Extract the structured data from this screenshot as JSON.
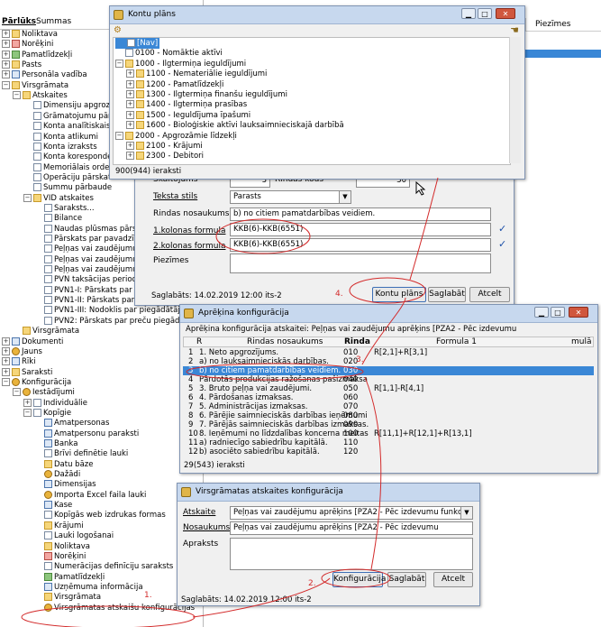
{
  "left_tabs": [
    "Pārlūks",
    "Summas"
  ],
  "left_tree": [
    {
      "label": "Noliktava",
      "level": 0,
      "expander": "+",
      "icon": "folder"
    },
    {
      "label": "Norēķini",
      "level": 0,
      "expander": "+",
      "icon": "red"
    },
    {
      "label": "Pamatlīdzekļi",
      "level": 0,
      "expander": "+",
      "icon": "green"
    },
    {
      "label": "Pasts",
      "level": 0,
      "expander": "+",
      "icon": "folder"
    },
    {
      "label": "Personāla vadība",
      "level": 0,
      "expander": "+",
      "icon": "blue"
    },
    {
      "label": "Virsgrāmata",
      "level": 0,
      "expander": "−",
      "icon": "folder"
    },
    {
      "label": "Atskaites",
      "level": 1,
      "expander": "−",
      "icon": "folder"
    },
    {
      "label": "Dimensiju apgrozīj",
      "level": 2,
      "expander": "",
      "icon": "doc"
    },
    {
      "label": "Grāmatojumu pārskat",
      "level": 2,
      "expander": "",
      "icon": "doc"
    },
    {
      "label": "Konta analītiskais",
      "level": 2,
      "expander": "",
      "icon": "doc"
    },
    {
      "label": "Konta atlikumi",
      "level": 2,
      "expander": "",
      "icon": "doc"
    },
    {
      "label": "Konta izraksts",
      "level": 2,
      "expander": "",
      "icon": "doc"
    },
    {
      "label": "Konta koresponde",
      "level": 2,
      "expander": "",
      "icon": "doc"
    },
    {
      "label": "Memoriālais orderis",
      "level": 2,
      "expander": "",
      "icon": "doc"
    },
    {
      "label": "Operāciju pārskats",
      "level": 2,
      "expander": "",
      "icon": "doc"
    },
    {
      "label": "Summu pārbaude",
      "level": 2,
      "expander": "",
      "icon": "doc"
    },
    {
      "label": "VID atskaites",
      "level": 2,
      "expander": "−",
      "icon": "folder"
    },
    {
      "label": "Saraksts...",
      "level": 3,
      "expander": "",
      "icon": "doc"
    },
    {
      "label": "Bilance",
      "level": 3,
      "expander": "",
      "icon": "doc"
    },
    {
      "label": "Naudas plūsmas pārskats",
      "level": 3,
      "expander": "",
      "icon": "doc"
    },
    {
      "label": "Pārskats par pavadzīmju nu",
      "level": 3,
      "expander": "",
      "icon": "doc"
    },
    {
      "label": "Peļņas vai zaudējumu aprēķins",
      "level": 3,
      "expander": "",
      "icon": "doc"
    },
    {
      "label": "Peļņas vai zaudējumu aprēķins",
      "level": 3,
      "expander": "",
      "icon": "doc"
    },
    {
      "label": "Peļņas vai zaudējumu aprēķins",
      "level": 3,
      "expander": "",
      "icon": "doc"
    },
    {
      "label": "PVN taksācijas perioda dek",
      "level": 3,
      "expander": "",
      "icon": "doc"
    },
    {
      "label": "PVN1-I: Pārskats par priekš",
      "level": 3,
      "expander": "",
      "icon": "doc"
    },
    {
      "label": "PVN1-II: Pārskats par prieks",
      "level": 3,
      "expander": "",
      "icon": "doc"
    },
    {
      "label": "PVN1-III: Nodoklis par piegādātājam p",
      "level": 3,
      "expander": "",
      "icon": "doc"
    },
    {
      "label": "PVN2: Pārskats par preču piegādēm",
      "level": 3,
      "expander": "",
      "icon": "doc"
    },
    {
      "label": "Virsgrāmata",
      "level": 1,
      "expander": "",
      "icon": "folder"
    },
    {
      "label": "Dokumenti",
      "level": 0,
      "expander": "+",
      "icon": "blue"
    },
    {
      "label": "Jauns",
      "level": 0,
      "expander": "+",
      "icon": "gear"
    },
    {
      "label": "Rīki",
      "level": 0,
      "expander": "+",
      "icon": "blue"
    },
    {
      "label": "Saraksti",
      "level": 0,
      "expander": "+",
      "icon": "folder"
    },
    {
      "label": "Konfigurācija",
      "level": 0,
      "expander": "−",
      "icon": "gear"
    },
    {
      "label": "Iestādījumi",
      "level": 1,
      "expander": "−",
      "icon": "gear"
    },
    {
      "label": "Individuālie",
      "level": 2,
      "expander": "+",
      "icon": "doc"
    },
    {
      "label": "Kopīgie",
      "level": 2,
      "expander": "−",
      "icon": "doc"
    },
    {
      "label": "Amatpersonas",
      "level": 3,
      "expander": "",
      "icon": "blue"
    },
    {
      "label": "Amatpersonu paraksti",
      "level": 3,
      "expander": "",
      "icon": "blue"
    },
    {
      "label": "Banka",
      "level": 3,
      "expander": "",
      "icon": "blue"
    },
    {
      "label": "Brīvi definētie lauki",
      "level": 3,
      "expander": "",
      "icon": "doc"
    },
    {
      "label": "Datu bāze",
      "level": 3,
      "expander": "",
      "icon": "folder"
    },
    {
      "label": "Dažādi",
      "level": 3,
      "expander": "",
      "icon": "gear"
    },
    {
      "label": "Dimensijas",
      "level": 3,
      "expander": "",
      "icon": "blue"
    },
    {
      "label": "Importa Excel faila lauki",
      "level": 3,
      "expander": "",
      "icon": "gear"
    },
    {
      "label": "Kase",
      "level": 3,
      "expander": "",
      "icon": "blue"
    },
    {
      "label": "Kopīgās web izdrukas formas",
      "level": 3,
      "expander": "",
      "icon": "doc"
    },
    {
      "label": "Krājumi",
      "level": 3,
      "expander": "",
      "icon": "folder"
    },
    {
      "label": "Lauki logošanai",
      "level": 3,
      "expander": "",
      "icon": "doc"
    },
    {
      "label": "Noliktava",
      "level": 3,
      "expander": "",
      "icon": "folder"
    },
    {
      "label": "Norēķini",
      "level": 3,
      "expander": "",
      "icon": "red"
    },
    {
      "label": "Numerācijas definīciju saraksts",
      "level": 3,
      "expander": "",
      "icon": "doc"
    },
    {
      "label": "Pamatlīdzekļi",
      "level": 3,
      "expander": "",
      "icon": "green"
    },
    {
      "label": "Uzņēmuma informācija",
      "level": 3,
      "expander": "",
      "icon": "blue"
    },
    {
      "label": "Virsgrāmata",
      "level": 3,
      "expander": "",
      "icon": "folder"
    },
    {
      "label": "Virsgrāmatas atskaišu konfigurācijas",
      "level": 3,
      "expander": "",
      "icon": "gear"
    }
  ],
  "bg_header": "Piezīmes",
  "kontu_plans": {
    "title": "Kontu plāns",
    "items": [
      {
        "label": "[Nav]",
        "level": 0,
        "expander": "",
        "icon": "doc",
        "selected": true
      },
      {
        "label": "0100 - Nomāktie aktīvi",
        "level": 0,
        "expander": "",
        "icon": "doc"
      },
      {
        "label": "1000 - Ilgtermiņa ieguldījumi",
        "level": 0,
        "expander": "−",
        "icon": "folder"
      },
      {
        "label": "1100 - Nemateriālie ieguldījumi",
        "level": 1,
        "expander": "+",
        "icon": "folder"
      },
      {
        "label": "1200 - Pamatlīdzekļi",
        "level": 1,
        "expander": "+",
        "icon": "folder"
      },
      {
        "label": "1300 - Ilgtermiņa finanšu ieguldījumi",
        "level": 1,
        "expander": "+",
        "icon": "folder"
      },
      {
        "label": "1400 - Ilgtermiņa prasības",
        "level": 1,
        "expander": "+",
        "icon": "folder"
      },
      {
        "label": "1500 - Ieguldījuma īpašumi",
        "level": 1,
        "expander": "+",
        "icon": "folder"
      },
      {
        "label": "1600 - Bioloģiskie aktīvi lauksaimnieciskajā darbībā",
        "level": 1,
        "expander": "+",
        "icon": "folder"
      },
      {
        "label": "2000 - Apgrozāmie līdzekļi",
        "level": 0,
        "expander": "−",
        "icon": "folder"
      },
      {
        "label": "2100 - Krājumi",
        "level": 1,
        "expander": "+",
        "icon": "folder"
      },
      {
        "label": "2300 - Debitori",
        "level": 1,
        "expander": "+",
        "icon": "folder"
      }
    ],
    "status": "900(944) ieraksti"
  },
  "row_form": {
    "skaitojums_label": "Skaitojums",
    "skaitojums_value": "3",
    "rindas_kods_label": "Rindas kods",
    "rindas_kods_value": "30",
    "teksta_stils_label": "Teksta stils",
    "teksta_stils_value": "Parasts",
    "rindas_nosaukums_label": "Rindas nosaukums",
    "rindas_nosaukums_value": "b) no citiem pamatdarbības veidiem.",
    "kolonna1_label": "1.kolonas formula",
    "kolonna1_value": "KKB(6)-KKB(6551)",
    "kolonna2_label": "2.kolonas formula",
    "kolonna2_value": "KKB(6)-KKB(6551)",
    "piezimes_label": "Piezīmes",
    "piezimes_value": "",
    "saglabats": "Saglabāts: 14.02.2019 12:00 its-2",
    "step_label": "4.",
    "kontu_plans_button": "Kontu plāns",
    "save_button": "Saglabāt",
    "cancel_button": "Atcelt"
  },
  "aprekina": {
    "title": "Aprēķina konfigurācija",
    "subtitle": "Aprēķina konfigurācija atskaitei: Peļņas vai zaudējumu aprēķins [PZA2 - Pēc izdevumu",
    "columns": [
      "R",
      "Rindas nosaukums",
      "Rinda",
      "Formula 1",
      "mulā"
    ],
    "rows": [
      {
        "r": "1",
        "name": "1. Neto apgrozījums.",
        "rinda": "010",
        "formula": "R[2,1]+R[3,1]"
      },
      {
        "r": "2",
        "name": "a) no lauksaimnieciskās darbības.",
        "rinda": "020",
        "formula": ""
      },
      {
        "r": "3",
        "name": "b) no citiem pamatdarbības veidiem.",
        "rinda": "030",
        "formula": "",
        "selected": true
      },
      {
        "r": "4",
        "name": "Pārdotās produkcijas ražošanas pašizmaksa",
        "rinda": "040",
        "formula": ""
      },
      {
        "r": "5",
        "name": "3. Bruto peļņa vai zaudējumi.",
        "rinda": "050",
        "formula": "R[1,1]-R[4,1]"
      },
      {
        "r": "6",
        "name": "4. Pārdošanas izmaksas.",
        "rinda": "060",
        "formula": ""
      },
      {
        "r": "7",
        "name": "5. Administrācijas izmaksas.",
        "rinda": "070",
        "formula": ""
      },
      {
        "r": "8",
        "name": "6. Pārējie saimnieciskās darbības ieņēmumi",
        "rinda": "080",
        "formula": ""
      },
      {
        "r": "9",
        "name": "7. Pārējās saimnieciskās darbības izmaksas.",
        "rinda": "090",
        "formula": ""
      },
      {
        "r": "10",
        "name": "8. Ieņēmumi no līdzdalības koncerna meitas",
        "rinda": "100",
        "formula": "R[11,1]+R[12,1]+R[13,1]"
      },
      {
        "r": "11",
        "name": "a) radniecīgo sabiedrību kapitālā.",
        "rinda": "110",
        "formula": ""
      },
      {
        "r": "12",
        "name": "b) asociēto sabiedrību kapitālā.",
        "rinda": "120",
        "formula": ""
      }
    ],
    "step_label": "3.",
    "status": "29(543) ieraksti"
  },
  "virsgramatas": {
    "title": "Virsgrāmatas atskaites konfigurācija",
    "atskaite_label": "Atskaite",
    "atskaite_value": "Peļņas vai zaudējumu aprēķins [PZA2 - Pēc izdevumu funkcijām]",
    "nosaukums_label": "Nosaukums",
    "nosaukums_value": "Peļņas vai zaudējumu aprēķins [PZA2 - Pēc izdevumu",
    "apraksts_label": "Apraksts",
    "apraksts_value": "",
    "step_label": "2.",
    "konfiguracija_button": "Konfigurācija",
    "save_button": "Saglabāt",
    "cancel_button": "Atcelt",
    "status": "Saglabāts: 14.02.2019 12:00 its-2"
  },
  "step1_label": "1.",
  "annotation_color": "#d32a2a",
  "selection_color": "#3a87d6"
}
